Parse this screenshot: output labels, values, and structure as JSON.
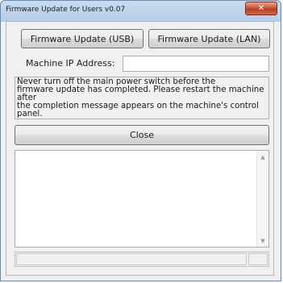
{
  "window": {
    "title": "Firmware Update for Users v0.07",
    "close_glyph": "✕"
  },
  "buttons": {
    "usb_label": "Firmware Update (USB)",
    "lan_label": "Firmware Update (LAN)",
    "close_label": "Close"
  },
  "ip": {
    "label": "Machine IP Address:",
    "value": ""
  },
  "notice": {
    "text": "Never turn off the main power switch before the\nfirmware update has completed. Please restart the machine\nafter\nthe completion message appears on the machine's control\npanel."
  },
  "log": {
    "scroll_up_glyph": "▲",
    "scroll_down_glyph": "▼"
  },
  "status": {
    "text": ""
  }
}
